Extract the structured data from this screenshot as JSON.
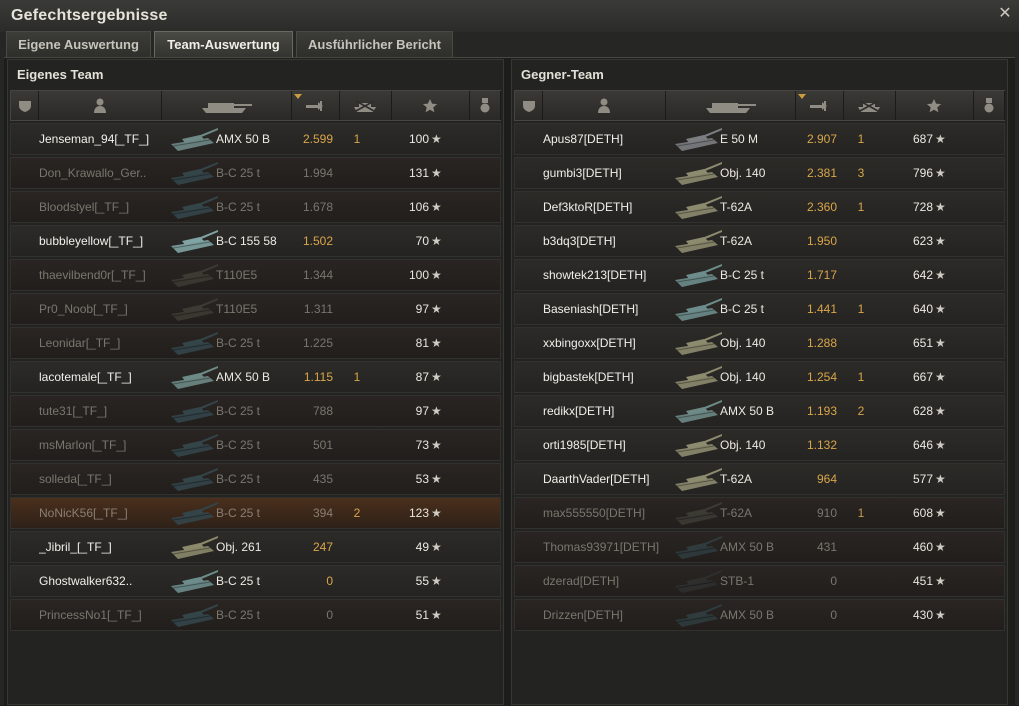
{
  "window": {
    "title": "Gefechtsergebnisse"
  },
  "tabs": [
    {
      "label": "Eigene Auswertung"
    },
    {
      "label": "Team-Auswertung"
    },
    {
      "label": "Ausführlicher Bericht"
    }
  ],
  "own_team": {
    "title": "Eigenes Team",
    "rows": [
      {
        "name": "Jenseman_94[_TF_]",
        "tank": "AMX 50 B",
        "damage": "2.599",
        "frags": "1",
        "xp": "100",
        "state": "alive",
        "tank_color": "#6e8a86"
      },
      {
        "name": "Don_Krawallo_Ger..",
        "tank": "B-C 25 t",
        "damage": "1.994",
        "frags": "",
        "xp": "131",
        "state": "dead",
        "tank_color": "#34454a"
      },
      {
        "name": "Bloodstyel[_TF_]",
        "tank": "B-C 25 t",
        "damage": "1.678",
        "frags": "",
        "xp": "106",
        "state": "dead",
        "tank_color": "#34454a"
      },
      {
        "name": "bubbleyellow[_TF_]",
        "tank": "B-C 155 58",
        "damage": "1.502",
        "frags": "",
        "xp": "70",
        "state": "alive",
        "tank_color": "#7fa4a3"
      },
      {
        "name": "thaevilbend0r[_TF_]",
        "tank": "T110E5",
        "damage": "1.344",
        "frags": "",
        "xp": "100",
        "state": "dead",
        "tank_color": "#3d3a33"
      },
      {
        "name": "Pr0_Noob[_TF_]",
        "tank": "T110E5",
        "damage": "1.311",
        "frags": "",
        "xp": "97",
        "state": "dead",
        "tank_color": "#3d3a33"
      },
      {
        "name": "Leonidar[_TF_]",
        "tank": "B-C 25 t",
        "damage": "1.225",
        "frags": "",
        "xp": "81",
        "state": "dead",
        "tank_color": "#34454a"
      },
      {
        "name": "lacotemale[_TF_]",
        "tank": "AMX 50 B",
        "damage": "1.115",
        "frags": "1",
        "xp": "87",
        "state": "alive",
        "tank_color": "#6e8a86"
      },
      {
        "name": "tute31[_TF_]",
        "tank": "B-C 25 t",
        "damage": "788",
        "frags": "",
        "xp": "97",
        "state": "dead",
        "tank_color": "#34454a"
      },
      {
        "name": "msMarlon[_TF_]",
        "tank": "B-C 25 t",
        "damage": "501",
        "frags": "",
        "xp": "73",
        "state": "dead",
        "tank_color": "#34454a"
      },
      {
        "name": "solleda[_TF_]",
        "tank": "B-C 25 t",
        "damage": "435",
        "frags": "",
        "xp": "53",
        "state": "dead",
        "tank_color": "#34454a"
      },
      {
        "name": "NoNicK56[_TF_]",
        "tank": "B-C 25 t",
        "damage": "394",
        "frags": "2",
        "xp": "123",
        "state": "orange",
        "tank_color": "#34454a"
      },
      {
        "name": "_Jibril_[_TF_]",
        "tank": "Obj. 261",
        "damage": "247",
        "frags": "",
        "xp": "49",
        "state": "alive",
        "tank_color": "#8c8a6a"
      },
      {
        "name": "Ghostwalker632..",
        "tank": "B-C 25 t",
        "damage": "0",
        "frags": "",
        "xp": "55",
        "state": "alive",
        "tank_color": "#6d8d8c"
      },
      {
        "name": "PrincessNo1[_TF_]",
        "tank": "B-C 25 t",
        "damage": "0",
        "frags": "",
        "xp": "51",
        "state": "dead",
        "tank_color": "#34454a"
      }
    ]
  },
  "enemy_team": {
    "title": "Gegner-Team",
    "rows": [
      {
        "name": "Apus87[DETH]",
        "tank": "E 50 M",
        "damage": "2.907",
        "frags": "1",
        "xp": "687",
        "state": "alive",
        "tank_color": "#7c7e82"
      },
      {
        "name": "gumbi3[DETH]",
        "tank": "Obj. 140",
        "damage": "2.381",
        "frags": "3",
        "xp": "796",
        "state": "alive",
        "tank_color": "#8d8b6e"
      },
      {
        "name": "Def3ktoR[DETH]",
        "tank": "T-62A",
        "damage": "2.360",
        "frags": "1",
        "xp": "728",
        "state": "alive",
        "tank_color": "#8d8b6e"
      },
      {
        "name": "b3dq3[DETH]",
        "tank": "T-62A",
        "damage": "1.950",
        "frags": "",
        "xp": "623",
        "state": "alive",
        "tank_color": "#8d8b6e"
      },
      {
        "name": "showtek213[DETH]",
        "tank": "B-C 25 t",
        "damage": "1.717",
        "frags": "",
        "xp": "642",
        "state": "alive",
        "tank_color": "#6d8d8c"
      },
      {
        "name": "Baseniash[DETH]",
        "tank": "B-C 25 t",
        "damage": "1.441",
        "frags": "1",
        "xp": "640",
        "state": "alive",
        "tank_color": "#6d8d8c"
      },
      {
        "name": "xxbingoxx[DETH]",
        "tank": "Obj. 140",
        "damage": "1.288",
        "frags": "",
        "xp": "651",
        "state": "alive",
        "tank_color": "#8d8b6e"
      },
      {
        "name": "bigbastek[DETH]",
        "tank": "Obj. 140",
        "damage": "1.254",
        "frags": "1",
        "xp": "667",
        "state": "alive",
        "tank_color": "#8d8b6e"
      },
      {
        "name": "redikx[DETH]",
        "tank": "AMX 50 B",
        "damage": "1.193",
        "frags": "2",
        "xp": "628",
        "state": "alive",
        "tank_color": "#6e8a86"
      },
      {
        "name": "orti1985[DETH]",
        "tank": "Obj. 140",
        "damage": "1.132",
        "frags": "",
        "xp": "646",
        "state": "alive",
        "tank_color": "#8d8b6e"
      },
      {
        "name": "DaarthVader[DETH]",
        "tank": "T-62A",
        "damage": "964",
        "frags": "",
        "xp": "577",
        "state": "alive",
        "tank_color": "#8d8b6e"
      },
      {
        "name": "max555550[DETH]",
        "tank": "T-62A",
        "damage": "910",
        "frags": "1",
        "xp": "608",
        "state": "dead",
        "tank_color": "#3b3a33"
      },
      {
        "name": "Thomas93971[DETH]",
        "tank": "AMX 50 B",
        "damage": "431",
        "frags": "",
        "xp": "460",
        "state": "dead",
        "tank_color": "#2f3b3d"
      },
      {
        "name": "dzerad[DETH]",
        "tank": "STB-1",
        "damage": "0",
        "frags": "",
        "xp": "451",
        "state": "dead",
        "tank_color": "#2e2f2d"
      },
      {
        "name": "Drizzen[DETH]",
        "tank": "AMX 50 B",
        "damage": "0",
        "frags": "",
        "xp": "430",
        "state": "dead",
        "tank_color": "#2f3b3d"
      }
    ]
  },
  "colors": {
    "accent": "#d9a64a",
    "star": "#cfccc3"
  },
  "icons": {
    "star_glyph": "★",
    "close_glyph": "✕"
  },
  "columns": [
    "squad-icon",
    "player-icon",
    "tank-icon",
    "damage-icon",
    "frags-icon",
    "xp-star-icon",
    "medal-icon"
  ]
}
